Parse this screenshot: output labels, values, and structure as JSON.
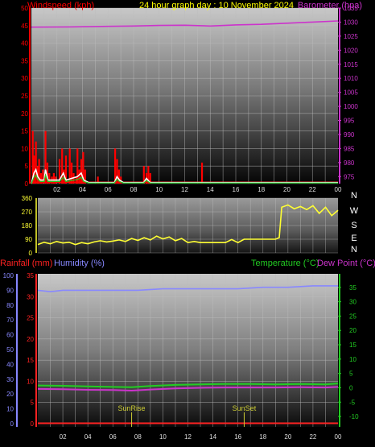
{
  "header": {
    "title": "24 hour graph day : 10 November 2024",
    "left_label": "Windspeed (kph)",
    "right_label": "Barometer (hpa)"
  },
  "bottom_header": {
    "rainfall_label": "Rainfall (mm)",
    "humidity_label": "Humidity (%)",
    "temperature_label": "Temperature (°C)",
    "dewpoint_label": "Dew Point (°C)"
  },
  "colors": {
    "windspeed": "#ff0000",
    "gust": "#ffffff",
    "barometer": "#cc33cc",
    "wind_dir": "#ffff33",
    "humidity": "#8888ff",
    "temperature": "#22cc22",
    "dewpoint": "#cc33cc",
    "rainfall": "#ff2222",
    "title": "#ffff00",
    "markers": "#cccc33"
  },
  "x_ticks": [
    "02",
    "04",
    "06",
    "08",
    "10",
    "12",
    "14",
    "16",
    "18",
    "20",
    "22",
    "00"
  ],
  "compass_labels": [
    "N",
    "W",
    "S",
    "E",
    "N"
  ],
  "markers": [
    {
      "label": "SunRise",
      "hour": 7.5
    },
    {
      "label": "SunSet",
      "hour": 16.5
    }
  ],
  "chart_data": [
    {
      "type": "bar",
      "title": "24 hour graph day : 10 November 2024",
      "x_range": [
        0,
        24
      ],
      "axes": {
        "left": {
          "label": "Windspeed (kph)",
          "range": [
            0,
            50
          ],
          "ticks": [
            "0",
            "5",
            "10",
            "15",
            "20",
            "25",
            "30",
            "35",
            "40",
            "45",
            "50"
          ]
        },
        "right": {
          "label": "Barometer (hpa)",
          "range": [
            972.5,
            1035
          ],
          "ticks": [
            "975",
            "980",
            "985",
            "990",
            "995",
            "1000",
            "1005",
            "1010",
            "1015",
            "1020",
            "1025",
            "1030",
            "1035"
          ]
        }
      },
      "series": [
        {
          "name": "Windspeed (kph)",
          "type": "bar",
          "points": [
            [
              0.1,
              15
            ],
            [
              0.2,
              8
            ],
            [
              0.35,
              12
            ],
            [
              0.5,
              5
            ],
            [
              0.6,
              7
            ],
            [
              0.75,
              3
            ],
            [
              0.9,
              4
            ],
            [
              1.1,
              15
            ],
            [
              1.25,
              6
            ],
            [
              1.4,
              3
            ],
            [
              1.6,
              2
            ],
            [
              1.75,
              3
            ],
            [
              1.9,
              2
            ],
            [
              2.2,
              7
            ],
            [
              2.4,
              10
            ],
            [
              2.55,
              4
            ],
            [
              2.7,
              8
            ],
            [
              3.0,
              10
            ],
            [
              3.15,
              6
            ],
            [
              3.3,
              3
            ],
            [
              3.5,
              2
            ],
            [
              3.6,
              10
            ],
            [
              3.75,
              4
            ],
            [
              3.9,
              7
            ],
            [
              4.05,
              9
            ],
            [
              4.2,
              4
            ],
            [
              5.2,
              2
            ],
            [
              6.55,
              10
            ],
            [
              6.7,
              7
            ],
            [
              6.85,
              4
            ],
            [
              7.0,
              2
            ],
            [
              8.8,
              5
            ],
            [
              9.0,
              3
            ],
            [
              9.15,
              5
            ],
            [
              9.3,
              3
            ],
            [
              13.35,
              6
            ]
          ]
        },
        {
          "name": "Gust",
          "type": "line",
          "points": [
            [
              0,
              0
            ],
            [
              0.2,
              3
            ],
            [
              0.35,
              4
            ],
            [
              0.5,
              2
            ],
            [
              0.7,
              1
            ],
            [
              1.0,
              1
            ],
            [
              1.1,
              4
            ],
            [
              1.3,
              1
            ],
            [
              2.2,
              1
            ],
            [
              2.5,
              3
            ],
            [
              2.7,
              1
            ],
            [
              3.6,
              2
            ],
            [
              3.9,
              3
            ],
            [
              4.1,
              1
            ],
            [
              4.5,
              0.3
            ],
            [
              6.5,
              0.3
            ],
            [
              6.7,
              2
            ],
            [
              6.9,
              1
            ],
            [
              7.2,
              0.3
            ],
            [
              8.8,
              0.3
            ],
            [
              9.0,
              1.5
            ],
            [
              9.3,
              0.3
            ],
            [
              24,
              0.3
            ]
          ]
        },
        {
          "name": "Barometer (hpa)",
          "type": "line",
          "axis": "right",
          "points": [
            [
              0,
              1028.2
            ],
            [
              3,
              1028.3
            ],
            [
              6,
              1028.5
            ],
            [
              8,
              1028.6
            ],
            [
              10,
              1028.8
            ],
            [
              12,
              1028.9
            ],
            [
              14,
              1028.6
            ],
            [
              16,
              1029.0
            ],
            [
              18,
              1029.2
            ],
            [
              20,
              1029.6
            ],
            [
              22,
              1030.0
            ],
            [
              24,
              1030.4
            ]
          ]
        }
      ]
    },
    {
      "type": "line",
      "x_range": [
        0,
        24
      ],
      "axes": {
        "left": {
          "range": [
            0,
            360
          ],
          "ticks": [
            "0",
            "90",
            "180",
            "270",
            "360"
          ]
        }
      },
      "series": [
        {
          "name": "Wind direction",
          "points": [
            [
              0,
              55
            ],
            [
              0.5,
              70
            ],
            [
              1,
              60
            ],
            [
              1.5,
              75
            ],
            [
              2,
              65
            ],
            [
              2.5,
              70
            ],
            [
              3,
              55
            ],
            [
              3.5,
              68
            ],
            [
              4,
              60
            ],
            [
              4.5,
              72
            ],
            [
              5,
              80
            ],
            [
              5.5,
              72
            ],
            [
              6,
              78
            ],
            [
              6.5,
              85
            ],
            [
              7,
              75
            ],
            [
              7.5,
              95
            ],
            [
              8,
              82
            ],
            [
              8.5,
              100
            ],
            [
              9,
              85
            ],
            [
              9.5,
              110
            ],
            [
              10,
              92
            ],
            [
              10.5,
              105
            ],
            [
              11,
              80
            ],
            [
              11.5,
              95
            ],
            [
              12,
              68
            ],
            [
              12.5,
              75
            ],
            [
              13,
              68
            ],
            [
              14,
              68
            ],
            [
              15,
              68
            ],
            [
              15.5,
              88
            ],
            [
              16,
              68
            ],
            [
              16.5,
              90
            ],
            [
              17,
              90
            ],
            [
              18,
              90
            ],
            [
              19,
              90
            ],
            [
              19.3,
              100
            ],
            [
              19.5,
              300
            ],
            [
              20,
              315
            ],
            [
              20.5,
              290
            ],
            [
              21,
              305
            ],
            [
              21.5,
              285
            ],
            [
              22,
              310
            ],
            [
              22.5,
              260
            ],
            [
              23,
              300
            ],
            [
              23.5,
              245
            ],
            [
              24,
              280
            ]
          ]
        }
      ]
    },
    {
      "type": "line",
      "x_range": [
        0,
        24
      ],
      "axes": {
        "left_outer": {
          "label": "Humidity (%)",
          "range": [
            0,
            100
          ],
          "ticks": [
            "0",
            "10",
            "20",
            "30",
            "40",
            "50",
            "60",
            "70",
            "80",
            "90",
            "100"
          ]
        },
        "left_inner": {
          "label": "Rainfall (mm)",
          "range": [
            0,
            35
          ],
          "ticks": [
            "0",
            "5",
            "10",
            "15",
            "20",
            "25",
            "30",
            "35"
          ]
        },
        "right": {
          "label": "Temperature (°C)",
          "range": [
            -12.5,
            40
          ],
          "ticks": [
            "-10",
            "-5",
            "0",
            "5",
            "10",
            "15",
            "20",
            "25",
            "30",
            "35"
          ]
        }
      },
      "series": [
        {
          "name": "Humidity (%)",
          "points": [
            [
              0,
              90
            ],
            [
              1,
              89
            ],
            [
              2,
              90
            ],
            [
              4,
              90
            ],
            [
              6,
              90
            ],
            [
              8,
              90
            ],
            [
              10,
              91
            ],
            [
              12,
              91
            ],
            [
              14,
              91
            ],
            [
              16,
              91
            ],
            [
              18,
              92
            ],
            [
              20,
              92
            ],
            [
              22,
              93
            ],
            [
              24,
              93
            ]
          ]
        },
        {
          "name": "Temperature (°C)",
          "points": [
            [
              0,
              0.8
            ],
            [
              2,
              0.7
            ],
            [
              4,
              0.5
            ],
            [
              6,
              0.3
            ],
            [
              7.5,
              0.2
            ],
            [
              9,
              0.6
            ],
            [
              11,
              1.0
            ],
            [
              13,
              1.2
            ],
            [
              15,
              1.3
            ],
            [
              17,
              1.3
            ],
            [
              19,
              1.2
            ],
            [
              21,
              1.3
            ],
            [
              23,
              1.2
            ],
            [
              24,
              1.5
            ]
          ]
        },
        {
          "name": "Dew Point (°C)",
          "points": [
            [
              0,
              -0.4
            ],
            [
              2,
              -0.5
            ],
            [
              4,
              -0.7
            ],
            [
              6,
              -0.8
            ],
            [
              7.5,
              -1.0
            ],
            [
              9,
              -0.6
            ],
            [
              11,
              -0.2
            ],
            [
              13,
              0
            ],
            [
              15,
              0.1
            ],
            [
              17,
              0.1
            ],
            [
              19,
              0.1
            ],
            [
              21,
              0.2
            ],
            [
              23,
              0.1
            ],
            [
              24,
              0.3
            ]
          ]
        },
        {
          "name": "Rainfall (mm)",
          "points": [
            [
              0,
              0.1
            ],
            [
              24,
              0.1
            ]
          ]
        }
      ]
    }
  ]
}
